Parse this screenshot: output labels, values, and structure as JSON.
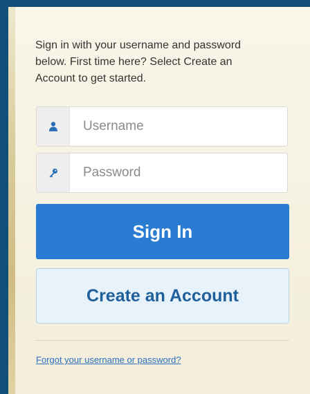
{
  "intro": {
    "text": "Sign in with your username and password below. First time here? Select Create an Account to get started."
  },
  "username": {
    "placeholder": "Username",
    "value": "",
    "icon": "user-icon"
  },
  "password": {
    "placeholder": "Password",
    "value": "",
    "icon": "key-icon"
  },
  "buttons": {
    "sign_in": "Sign In",
    "create_account": "Create an Account"
  },
  "links": {
    "forgot": "Forgot your username or password?"
  },
  "colors": {
    "primary": "#2a7bd2",
    "secondary_bg": "#e7f2fb",
    "secondary_text": "#1f5f9a",
    "frame": "#0f4f7a"
  }
}
